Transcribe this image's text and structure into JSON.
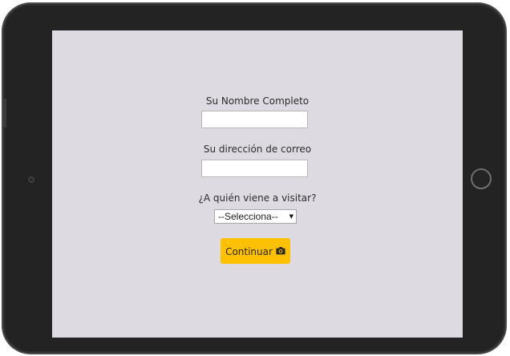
{
  "form": {
    "name_label": "Su Nombre Completo",
    "name_value": "",
    "email_label": "Su dirección de correo",
    "email_value": "",
    "visit_label": "¿A quién viene a visitar?",
    "visit_selected": "--Selecciona--",
    "continue_label": "Continuar",
    "continue_icon": "camera-icon"
  },
  "colors": {
    "frame": "#232323",
    "screen_background": "#dedae2",
    "button_background": "#ffc000",
    "text": "#2c2c2c"
  }
}
